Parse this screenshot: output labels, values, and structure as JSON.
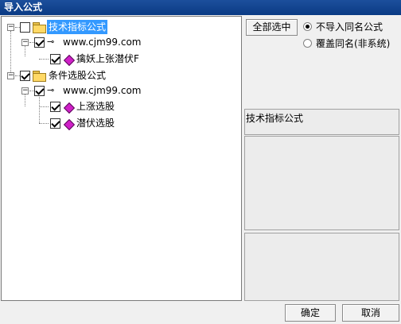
{
  "window": {
    "title": "导入公式"
  },
  "tree": {
    "groups": [
      {
        "label": "技术指标公式",
        "checked": false,
        "source": {
          "label": "www.cjm99.com",
          "checked": true,
          "items": [
            {
              "label": "擒妖上张潜伏F",
              "checked": true
            }
          ]
        }
      },
      {
        "label": "条件选股公式",
        "checked": true,
        "source": {
          "label": "www.cjm99.com",
          "checked": true,
          "items": [
            {
              "label": "上涨选股",
              "checked": true
            },
            {
              "label": "潜伏选股",
              "checked": true
            }
          ]
        }
      }
    ]
  },
  "options": {
    "select_all_label": "全部选中",
    "radios": [
      {
        "label": "不导入同名公式",
        "selected": true
      },
      {
        "label": "覆盖同名(非系统)",
        "selected": false
      }
    ]
  },
  "info": {
    "category_text": "技术指标公式"
  },
  "footer": {
    "ok_label": "确定",
    "cancel_label": "取消"
  }
}
